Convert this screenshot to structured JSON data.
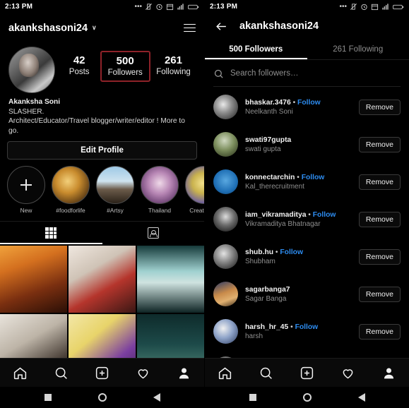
{
  "status_bar": {
    "time": "2:13 PM",
    "icons": [
      "more-dots-icon",
      "vibrate-off-icon",
      "alarm-icon",
      "calendar-icon",
      "signal-icon",
      "battery-icon"
    ]
  },
  "left_pane": {
    "header": {
      "username": "akankshasoni24",
      "caret": "∨",
      "menu_icon": "hamburger-menu-icon"
    },
    "stats": [
      {
        "number": "42",
        "label": "Posts",
        "highlighted": false
      },
      {
        "number": "500",
        "label": "Followers",
        "highlighted": true
      },
      {
        "number": "261",
        "label": "Following",
        "highlighted": false
      }
    ],
    "highlight_color": "#8e2229",
    "bio": {
      "name": "Akanksha Soni",
      "line2": "SLASHER.",
      "line3": "Architect/Educator/Travel blogger/writer/editor ! More to go."
    },
    "edit_profile_label": "Edit Profile",
    "highlights": [
      {
        "label": "New",
        "type": "new"
      },
      {
        "label": "#foodforlife",
        "type": "t-food"
      },
      {
        "label": "#Artsy",
        "type": "t-arts"
      },
      {
        "label": "Thailand",
        "type": "t-thai"
      },
      {
        "label": "Creative W",
        "type": "t-crea"
      }
    ],
    "profile_tabs": [
      {
        "icon": "grid-icon",
        "active": true
      },
      {
        "icon": "tagged-photos-icon",
        "active": false
      }
    ],
    "photo_grid": [
      {
        "name": "post-thumbnail-1",
        "css": "linear-gradient(160deg,#f0a23c 0%,#d4701f 30%,#7a2f10 65%,#2a0f06 100%)"
      },
      {
        "name": "post-thumbnail-2",
        "css": "linear-gradient(150deg,#efe7df 0%,#cfc3b6 35%,#b5352c 62%,#3a1714 100%)"
      },
      {
        "name": "post-thumbnail-3",
        "css": "linear-gradient(180deg,#163a3a 0%,#9fd0cf 38%,#cfe3e0 55%,#0e2424 100%)"
      },
      {
        "name": "post-thumbnail-4",
        "css": "linear-gradient(150deg,#e9e4dc 0%,#bdb4a7 40%,#4a4038 75%,#1a1512 100%)"
      },
      {
        "name": "post-thumbnail-5",
        "css": "linear-gradient(140deg,#f3e7a8 0%,#e8d46a 35%,#7b3fa0 70%,#3b1f52 100%)"
      },
      {
        "name": "post-thumbnail-6",
        "css": "linear-gradient(180deg,#0e2b2b 0%,#1d4a49 45%,#3a6b63 70%,#080f0f 100%)"
      }
    ],
    "bottom_nav": [
      "home-icon",
      "search-icon",
      "add-post-icon",
      "activity-heart-icon",
      "profile-icon"
    ]
  },
  "right_pane": {
    "header": {
      "back_icon": "back-arrow-icon",
      "title": "akankshasoni24"
    },
    "tabs": [
      {
        "label": "500 Followers",
        "active": true
      },
      {
        "label": "261 Following",
        "active": false
      }
    ],
    "search": {
      "icon": "search-icon",
      "placeholder": "Search followers…",
      "value": ""
    },
    "follow_link_color": "#2d8cf0",
    "remove_label": "Remove",
    "followers": [
      {
        "username": "bhaskar.3476",
        "follow": "Follow",
        "fullname": "Neelkanth Soni",
        "avatar": "av1"
      },
      {
        "username": "swati97gupta",
        "follow": "",
        "fullname": "swati gupta",
        "avatar": "av2"
      },
      {
        "username": "konnectarchin",
        "follow": "Follow",
        "fullname": "Kal_therecruitment",
        "avatar": "av3"
      },
      {
        "username": "iam_vikramaditya",
        "follow": "Follow",
        "fullname": "Vikramaditya Bhatnagar",
        "avatar": "av4"
      },
      {
        "username": "shub.hu",
        "follow": "Follow",
        "fullname": "Shubham",
        "avatar": "av5"
      },
      {
        "username": "sagarbanga7",
        "follow": "",
        "fullname": "Sagar Banga",
        "avatar": "av6"
      },
      {
        "username": "harsh_hr_45",
        "follow": "Follow",
        "fullname": "harsh",
        "avatar": "av7"
      }
    ],
    "bottom_nav": [
      "home-icon",
      "search-icon",
      "add-post-icon",
      "activity-heart-icon",
      "profile-icon"
    ]
  },
  "android_nav": [
    "recents-square-icon",
    "home-circle-icon",
    "back-triangle-icon"
  ]
}
